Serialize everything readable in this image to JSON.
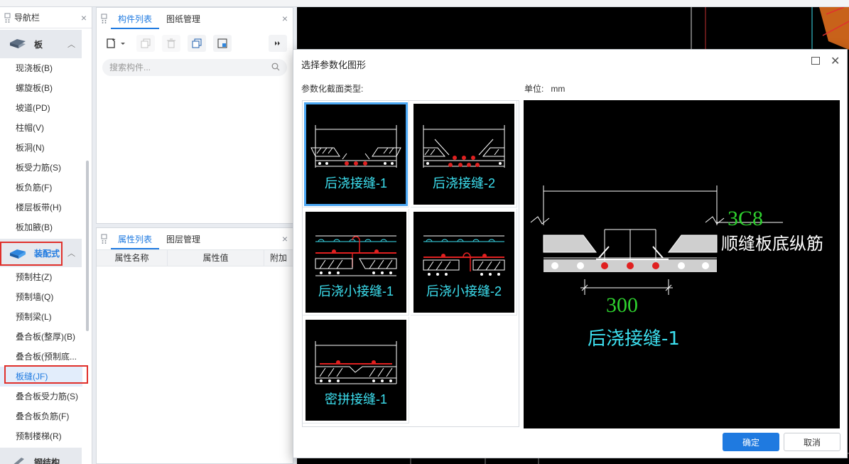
{
  "nav": {
    "title": "导航栏",
    "groups": [
      {
        "label": "板"
      },
      {
        "label": "装配式"
      },
      {
        "label": "钢结构"
      }
    ],
    "board_items": [
      "现浇板(B)",
      "螺旋板(B)",
      "坡道(PD)",
      "柱帽(V)",
      "板洞(N)",
      "板受力筋(S)",
      "板负筋(F)",
      "楼层板带(H)",
      "板加腋(B)"
    ],
    "prefab_items": [
      "预制柱(Z)",
      "预制墙(Q)",
      "预制梁(L)",
      "叠合板(整厚)(B)",
      "叠合板(预制底...",
      "板缝(JF)",
      "叠合板受力筋(S)",
      "叠合板负筋(F)",
      "预制楼梯(R)"
    ]
  },
  "component_panel": {
    "tabs": [
      "构件列表",
      "图纸管理"
    ],
    "search_placeholder": "搜索构件..."
  },
  "property_panel": {
    "tabs": [
      "属性列表",
      "图层管理"
    ],
    "columns": [
      "属性名称",
      "属性值",
      "附加"
    ]
  },
  "dialog": {
    "title": "选择参数化图形",
    "section_label": "参数化截面类型:",
    "unit_label": "单位:",
    "unit_value": "mm",
    "options": [
      "后浇接缝-1",
      "后浇接缝-2",
      "后浇小接缝-1",
      "后浇小接缝-2",
      "密拼接缝-1"
    ],
    "selected_index": 0,
    "preview": {
      "rebar_label": "3C8",
      "rebar_desc": "顺缝板底纵筋",
      "dimension": "300",
      "caption": "后浇接缝-1"
    },
    "ok": "确定",
    "cancel": "取消"
  },
  "colors": {
    "accent": "#1f7ae0",
    "highlight": "#e0302b",
    "cad_cyan": "#3de0f0",
    "cad_green": "#2ed12e"
  }
}
